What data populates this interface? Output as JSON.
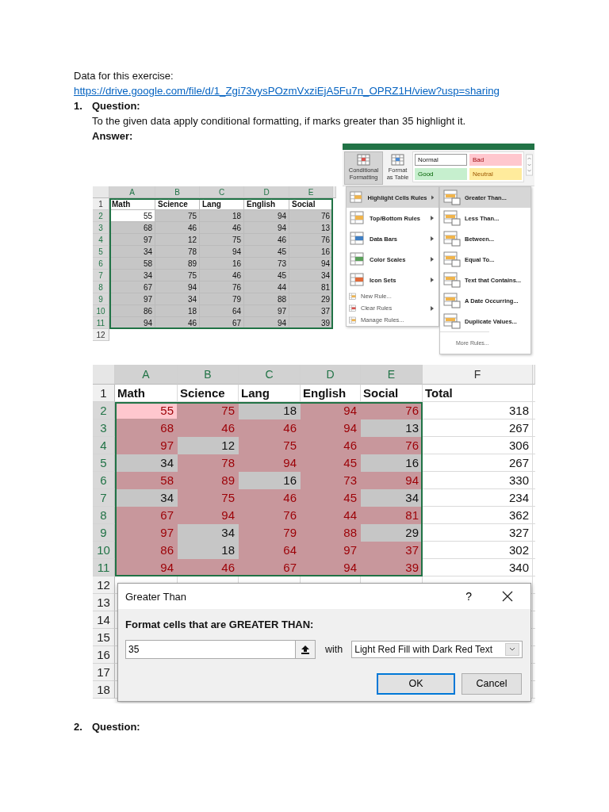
{
  "intro": {
    "label": "Data for this exercise:",
    "link": "https://drive.google.com/file/d/1_Zgi73vysPOzmVxziEjA5Fu7n_OPRZ1H/view?usp=sharing"
  },
  "questions": [
    {
      "number": "1.",
      "title": "Question:",
      "text": "To the given data apply conditional formatting, if marks greater than 35 highlight it.",
      "answer_label": "Answer:"
    },
    {
      "number": "2.",
      "title": "Question:"
    }
  ],
  "sheet_small": {
    "columns": [
      "A",
      "B",
      "C",
      "D",
      "E"
    ],
    "header_row": "1",
    "headers": [
      "Math",
      "Science",
      "Lang",
      "English",
      "Social"
    ],
    "last_row": "12",
    "rows": [
      {
        "number": "2",
        "cells": [
          {
            "value": "55",
            "active": true
          },
          {
            "value": "75",
            "active": false
          },
          {
            "value": "18",
            "active": false
          },
          {
            "value": "94",
            "active": false
          },
          {
            "value": "76",
            "active": false
          }
        ]
      },
      {
        "number": "3",
        "cells": [
          {
            "value": "68",
            "active": false
          },
          {
            "value": "46",
            "active": false
          },
          {
            "value": "46",
            "active": false
          },
          {
            "value": "94",
            "active": false
          },
          {
            "value": "13",
            "active": false
          }
        ]
      },
      {
        "number": "4",
        "cells": [
          {
            "value": "97",
            "active": false
          },
          {
            "value": "12",
            "active": false
          },
          {
            "value": "75",
            "active": false
          },
          {
            "value": "46",
            "active": false
          },
          {
            "value": "76",
            "active": false
          }
        ]
      },
      {
        "number": "5",
        "cells": [
          {
            "value": "34",
            "active": false
          },
          {
            "value": "78",
            "active": false
          },
          {
            "value": "94",
            "active": false
          },
          {
            "value": "45",
            "active": false
          },
          {
            "value": "16",
            "active": false
          }
        ]
      },
      {
        "number": "6",
        "cells": [
          {
            "value": "58",
            "active": false
          },
          {
            "value": "89",
            "active": false
          },
          {
            "value": "16",
            "active": false
          },
          {
            "value": "73",
            "active": false
          },
          {
            "value": "94",
            "active": false
          }
        ]
      },
      {
        "number": "7",
        "cells": [
          {
            "value": "34",
            "active": false
          },
          {
            "value": "75",
            "active": false
          },
          {
            "value": "46",
            "active": false
          },
          {
            "value": "45",
            "active": false
          },
          {
            "value": "34",
            "active": false
          }
        ]
      },
      {
        "number": "8",
        "cells": [
          {
            "value": "67",
            "active": false
          },
          {
            "value": "94",
            "active": false
          },
          {
            "value": "76",
            "active": false
          },
          {
            "value": "44",
            "active": false
          },
          {
            "value": "81",
            "active": false
          }
        ]
      },
      {
        "number": "9",
        "cells": [
          {
            "value": "97",
            "active": false
          },
          {
            "value": "34",
            "active": false
          },
          {
            "value": "79",
            "active": false
          },
          {
            "value": "88",
            "active": false
          },
          {
            "value": "29",
            "active": false
          }
        ]
      },
      {
        "number": "10",
        "cells": [
          {
            "value": "86",
            "active": false
          },
          {
            "value": "18",
            "active": false
          },
          {
            "value": "64",
            "active": false
          },
          {
            "value": "97",
            "active": false
          },
          {
            "value": "37",
            "active": false
          }
        ]
      },
      {
        "number": "11",
        "cells": [
          {
            "value": "94",
            "active": false
          },
          {
            "value": "46",
            "active": false
          },
          {
            "value": "67",
            "active": false
          },
          {
            "value": "94",
            "active": false
          },
          {
            "value": "39",
            "active": false
          }
        ]
      }
    ]
  },
  "ribbon": {
    "buttons": [
      {
        "label": "Conditional Formatting",
        "selected": true
      },
      {
        "label": "Format as Table",
        "selected": false
      }
    ],
    "styles": [
      {
        "label": "Normal",
        "kind": "normal"
      },
      {
        "label": "Bad",
        "kind": "bad"
      },
      {
        "label": "Good",
        "kind": "good"
      },
      {
        "label": "Neutral",
        "kind": "neutral"
      }
    ]
  },
  "menu": {
    "items": [
      {
        "label": "Highlight Cells Rules",
        "kind": "large",
        "submenu": true,
        "selected": true
      },
      {
        "label": "Top/Bottom Rules",
        "kind": "large",
        "submenu": true,
        "selected": false
      },
      {
        "label": "Data Bars",
        "kind": "large",
        "submenu": true,
        "selected": false
      },
      {
        "label": "Color Scales",
        "kind": "large",
        "submenu": true,
        "selected": false
      },
      {
        "label": "Icon Sets",
        "kind": "large",
        "submenu": true,
        "selected": false
      },
      {
        "label": "New Rule...",
        "kind": "small",
        "submenu": false,
        "selected": false
      },
      {
        "label": "Clear Rules",
        "kind": "small",
        "submenu": true,
        "selected": false
      },
      {
        "label": "Manage Rules...",
        "kind": "small",
        "submenu": false,
        "selected": false
      }
    ]
  },
  "submenu": {
    "items": [
      {
        "label": "Greater Than...",
        "selected": true
      },
      {
        "label": "Less Than...",
        "selected": false
      },
      {
        "label": "Between...",
        "selected": false
      },
      {
        "label": "Equal To...",
        "selected": false
      },
      {
        "label": "Text that Contains...",
        "selected": false
      },
      {
        "label": "A Date Occurring...",
        "selected": false
      },
      {
        "label": "Duplicate Values...",
        "selected": false
      }
    ],
    "more": "More Rules..."
  },
  "sheet_large": {
    "columns": [
      "A",
      "B",
      "C",
      "D",
      "E",
      "F"
    ],
    "header_row": "1",
    "headers": [
      "Math",
      "Science",
      "Lang",
      "English",
      "Social",
      "Total"
    ],
    "empty_rows": [
      "12",
      "13",
      "14",
      "15",
      "16",
      "17",
      "18"
    ],
    "rows": [
      {
        "number": "2",
        "total": "318",
        "cells": [
          {
            "value": "55",
            "highlighted": true,
            "active": true
          },
          {
            "value": "75",
            "highlighted": true,
            "active": false
          },
          {
            "value": "18",
            "highlighted": false,
            "active": false
          },
          {
            "value": "94",
            "highlighted": true,
            "active": false
          },
          {
            "value": "76",
            "highlighted": true,
            "active": false
          }
        ]
      },
      {
        "number": "3",
        "total": "267",
        "cells": [
          {
            "value": "68",
            "highlighted": true,
            "active": false
          },
          {
            "value": "46",
            "highlighted": true,
            "active": false
          },
          {
            "value": "46",
            "highlighted": true,
            "active": false
          },
          {
            "value": "94",
            "highlighted": true,
            "active": false
          },
          {
            "value": "13",
            "highlighted": false,
            "active": false
          }
        ]
      },
      {
        "number": "4",
        "total": "306",
        "cells": [
          {
            "value": "97",
            "highlighted": true,
            "active": false
          },
          {
            "value": "12",
            "highlighted": false,
            "active": false
          },
          {
            "value": "75",
            "highlighted": true,
            "active": false
          },
          {
            "value": "46",
            "highlighted": true,
            "active": false
          },
          {
            "value": "76",
            "highlighted": true,
            "active": false
          }
        ]
      },
      {
        "number": "5",
        "total": "267",
        "cells": [
          {
            "value": "34",
            "highlighted": false,
            "active": false
          },
          {
            "value": "78",
            "highlighted": true,
            "active": false
          },
          {
            "value": "94",
            "highlighted": true,
            "active": false
          },
          {
            "value": "45",
            "highlighted": true,
            "active": false
          },
          {
            "value": "16",
            "highlighted": false,
            "active": false
          }
        ]
      },
      {
        "number": "6",
        "total": "330",
        "cells": [
          {
            "value": "58",
            "highlighted": true,
            "active": false
          },
          {
            "value": "89",
            "highlighted": true,
            "active": false
          },
          {
            "value": "16",
            "highlighted": false,
            "active": false
          },
          {
            "value": "73",
            "highlighted": true,
            "active": false
          },
          {
            "value": "94",
            "highlighted": true,
            "active": false
          }
        ]
      },
      {
        "number": "7",
        "total": "234",
        "cells": [
          {
            "value": "34",
            "highlighted": false,
            "active": false
          },
          {
            "value": "75",
            "highlighted": true,
            "active": false
          },
          {
            "value": "46",
            "highlighted": true,
            "active": false
          },
          {
            "value": "45",
            "highlighted": true,
            "active": false
          },
          {
            "value": "34",
            "highlighted": false,
            "active": false
          }
        ]
      },
      {
        "number": "8",
        "total": "362",
        "cells": [
          {
            "value": "67",
            "highlighted": true,
            "active": false
          },
          {
            "value": "94",
            "highlighted": true,
            "active": false
          },
          {
            "value": "76",
            "highlighted": true,
            "active": false
          },
          {
            "value": "44",
            "highlighted": true,
            "active": false
          },
          {
            "value": "81",
            "highlighted": true,
            "active": false
          }
        ]
      },
      {
        "number": "9",
        "total": "327",
        "cells": [
          {
            "value": "97",
            "highlighted": true,
            "active": false
          },
          {
            "value": "34",
            "highlighted": false,
            "active": false
          },
          {
            "value": "79",
            "highlighted": true,
            "active": false
          },
          {
            "value": "88",
            "highlighted": true,
            "active": false
          },
          {
            "value": "29",
            "highlighted": false,
            "active": false
          }
        ]
      },
      {
        "number": "10",
        "total": "302",
        "cells": [
          {
            "value": "86",
            "highlighted": true,
            "active": false
          },
          {
            "value": "18",
            "highlighted": false,
            "active": false
          },
          {
            "value": "64",
            "highlighted": true,
            "active": false
          },
          {
            "value": "97",
            "highlighted": true,
            "active": false
          },
          {
            "value": "37",
            "highlighted": true,
            "active": false
          }
        ]
      },
      {
        "number": "11",
        "total": "340",
        "cells": [
          {
            "value": "94",
            "highlighted": true,
            "active": false
          },
          {
            "value": "46",
            "highlighted": true,
            "active": false
          },
          {
            "value": "67",
            "highlighted": true,
            "active": false
          },
          {
            "value": "94",
            "highlighted": true,
            "active": false
          },
          {
            "value": "39",
            "highlighted": true,
            "active": false
          }
        ]
      }
    ]
  },
  "dialog": {
    "title": "Greater Than",
    "help": "?",
    "prompt": "Format cells that are GREATER THAN:",
    "value": "35",
    "with_label": "with",
    "format": "Light Red Fill with Dark Red Text",
    "buttons": [
      {
        "label": "OK",
        "default": true
      },
      {
        "label": "Cancel",
        "default": false
      }
    ]
  }
}
